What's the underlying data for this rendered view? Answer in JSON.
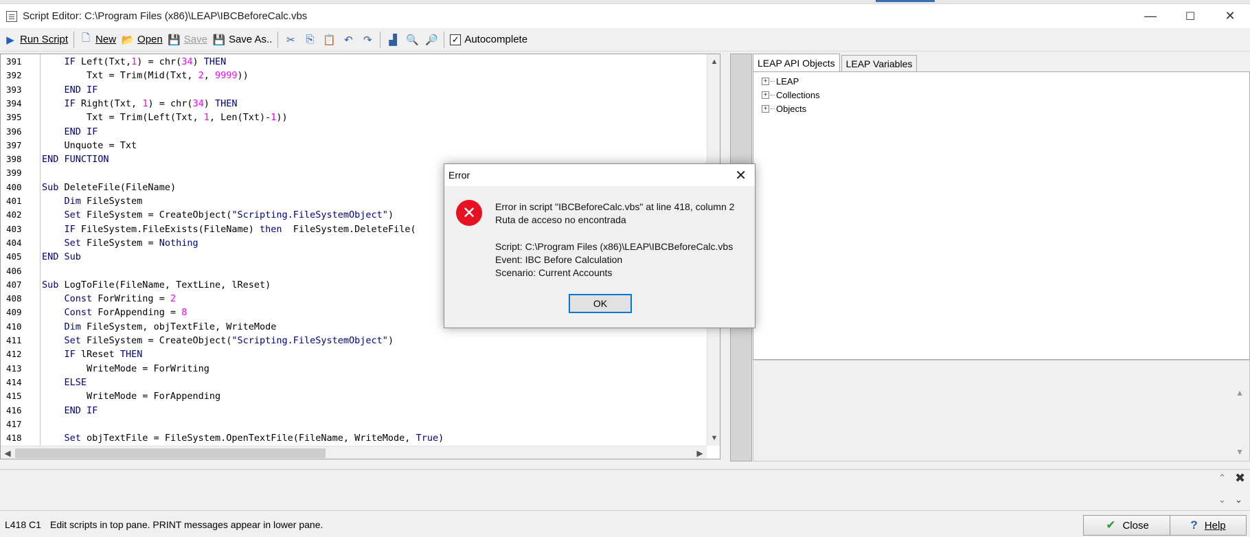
{
  "window": {
    "title": "Script Editor: C:\\Program Files (x86)\\LEAP\\IBCBeforeCalc.vbs",
    "minimize": "—",
    "maximize": "☐",
    "close": "✕"
  },
  "toolbar": {
    "run_script": "Run Script",
    "new": "New",
    "open": "Open",
    "save": "Save",
    "save_as": "Save As..",
    "autocomplete": "Autocomplete",
    "autocomplete_checked": true
  },
  "editor": {
    "lines": [
      {
        "n": "391",
        "text": "    IF Left(Txt,1) = chr(34) THEN"
      },
      {
        "n": "392",
        "text": "        Txt = Trim(Mid(Txt, 2, 9999))"
      },
      {
        "n": "393",
        "text": "    END IF"
      },
      {
        "n": "394",
        "text": "    IF Right(Txt, 1) = chr(34) THEN"
      },
      {
        "n": "395",
        "text": "        Txt = Trim(Left(Txt, 1, Len(Txt)-1))"
      },
      {
        "n": "396",
        "text": "    END IF"
      },
      {
        "n": "397",
        "text": "    Unquote = Txt"
      },
      {
        "n": "398",
        "text": "END FUNCTION"
      },
      {
        "n": "399",
        "text": ""
      },
      {
        "n": "400",
        "text": "Sub DeleteFile(FileName)"
      },
      {
        "n": "401",
        "text": "    Dim FileSystem"
      },
      {
        "n": "402",
        "text": "    Set FileSystem = CreateObject(\"Scripting.FileSystemObject\")"
      },
      {
        "n": "403",
        "text": "    IF FileSystem.FileExists(FileName) then  FileSystem.DeleteFile("
      },
      {
        "n": "404",
        "text": "    Set FileSystem = Nothing"
      },
      {
        "n": "405",
        "text": "END Sub"
      },
      {
        "n": "406",
        "text": ""
      },
      {
        "n": "407",
        "text": "Sub LogToFile(FileName, TextLine, lReset)"
      },
      {
        "n": "408",
        "text": "    Const ForWriting = 2"
      },
      {
        "n": "409",
        "text": "    Const ForAppending = 8"
      },
      {
        "n": "410",
        "text": "    Dim FileSystem, objTextFile, WriteMode"
      },
      {
        "n": "411",
        "text": "    Set FileSystem = CreateObject(\"Scripting.FileSystemObject\")"
      },
      {
        "n": "412",
        "text": "    IF lReset THEN"
      },
      {
        "n": "413",
        "text": "        WriteMode = ForWriting"
      },
      {
        "n": "414",
        "text": "    ELSE"
      },
      {
        "n": "415",
        "text": "        WriteMode = ForAppending"
      },
      {
        "n": "416",
        "text": "    END IF"
      },
      {
        "n": "417",
        "text": ""
      },
      {
        "n": "418",
        "text": "    Set objTextFile = FileSystem.OpenTextFile(FileName, WriteMode, True)"
      }
    ]
  },
  "right_panel": {
    "tabs": [
      "LEAP API Objects",
      "LEAP Variables"
    ],
    "tree": [
      "LEAP",
      "Collections",
      "Objects"
    ]
  },
  "status": {
    "position": "L418 C1",
    "message": "Edit scripts in top pane. PRINT messages appear in lower pane.",
    "close_label": "Close",
    "help_label": "Help"
  },
  "dialog": {
    "title": "Error",
    "line1": "Error in script \"IBCBeforeCalc.vbs\" at line 418, column 2",
    "line2": "Ruta de acceso no encontrada",
    "line3": "Script: C:\\Program Files (x86)\\LEAP\\IBCBeforeCalc.vbs",
    "line4": "Event: IBC Before Calculation",
    "line5": "Scenario: Current Accounts",
    "ok_label": "OK"
  },
  "colors": {
    "keyword": "#000080",
    "number": "#ff00ff",
    "error_red": "#e81123",
    "focus_blue": "#0078d7"
  }
}
